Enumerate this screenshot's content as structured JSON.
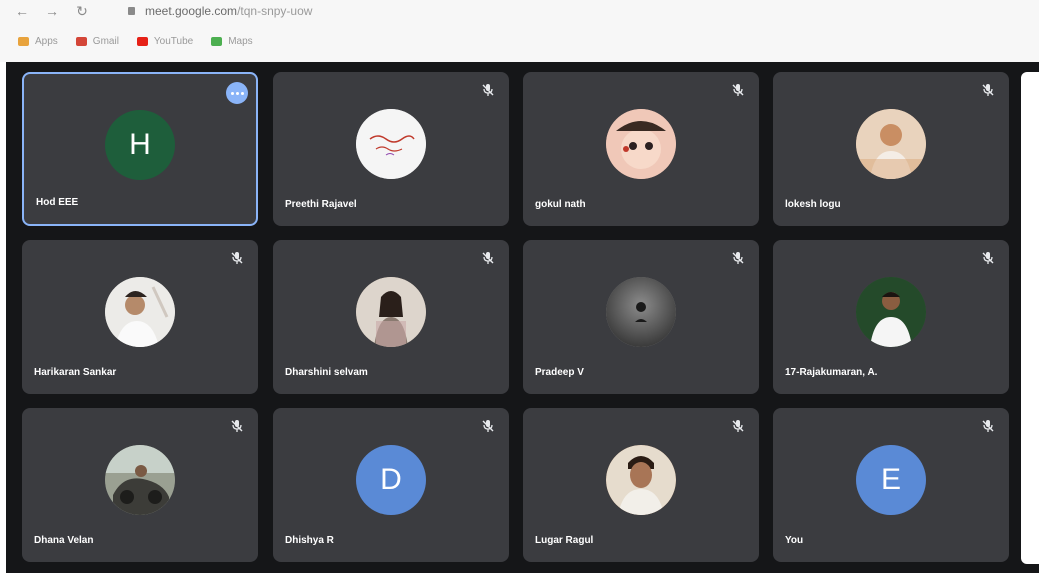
{
  "browser": {
    "url_host": "meet.google.com",
    "url_path": "/tqn-snpy-uow",
    "bookmarks": [
      {
        "label": "Apps",
        "color": "#e8a33d"
      },
      {
        "label": "Gmail",
        "color": "#d44638"
      },
      {
        "label": "YouTube",
        "color": "#e62117"
      },
      {
        "label": "Maps",
        "color": "#4caf50"
      }
    ]
  },
  "colors": {
    "stage_bg": "#151618",
    "tile_bg": "#3b3c40",
    "active_border": "#8ab4f8"
  },
  "participants": [
    {
      "name": "Hod EEE",
      "avatar": "letter",
      "letter": "H",
      "avatar_color": "#1e5e3b",
      "active": true,
      "icon": "more-options-icon"
    },
    {
      "name": "Preethi Rajavel",
      "avatar": "photo",
      "avatar_color": "#f2f2f2",
      "icon": "mic-off-icon"
    },
    {
      "name": "gokul nath",
      "avatar": "photo",
      "avatar_color": "#e9b8a8",
      "icon": "mic-off-icon"
    },
    {
      "name": "lokesh logu",
      "avatar": "photo",
      "avatar_color": "#e7c6a5",
      "icon": "mic-off-icon"
    },
    {
      "name": "Harikaran Sankar",
      "avatar": "photo",
      "avatar_color": "#e3e0dc",
      "icon": "mic-off-icon"
    },
    {
      "name": "Dharshini selvam",
      "avatar": "photo",
      "avatar_color": "#c9b8a8",
      "icon": "mic-off-icon"
    },
    {
      "name": "Pradeep V",
      "avatar": "photo",
      "avatar_color": "#6e6e6e",
      "icon": "mic-off-icon"
    },
    {
      "name": "17-Rajakumaran, A.",
      "avatar": "photo",
      "avatar_color": "#2f5a33",
      "icon": "mic-off-icon"
    },
    {
      "name": "Dhana Velan",
      "avatar": "photo",
      "avatar_color": "#8a8f86",
      "icon": "mic-off-icon"
    },
    {
      "name": "Dhishya R",
      "avatar": "letter",
      "letter": "D",
      "avatar_color": "#5a8ad6",
      "icon": "mic-off-icon"
    },
    {
      "name": "Lugar Ragul",
      "avatar": "photo",
      "avatar_color": "#b08a6a",
      "icon": "mic-off-icon"
    },
    {
      "name": "You",
      "avatar": "letter",
      "letter": "E",
      "avatar_color": "#5a8ad6",
      "icon": "mic-off-icon"
    }
  ]
}
